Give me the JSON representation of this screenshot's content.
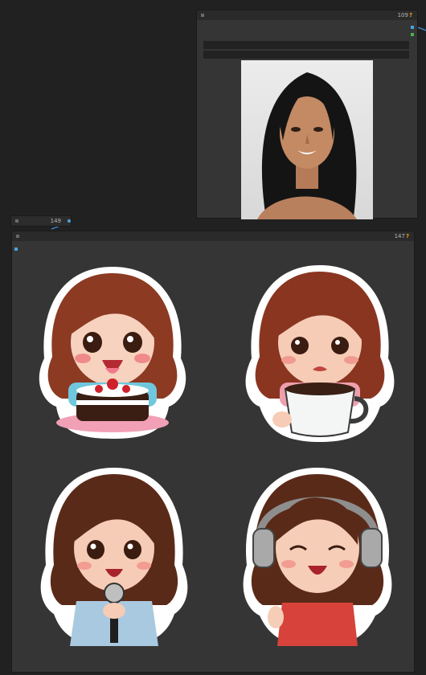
{
  "nodes": {
    "load_image": {
      "id": "109",
      "q": "?"
    },
    "reroute": {
      "id": "149"
    },
    "preview": {
      "id": "147",
      "q": "?"
    }
  },
  "colors": {
    "canvas": "#212121",
    "node_body": "#353535",
    "node_header": "#2a2a2a",
    "badge": "#f0a020",
    "port_blue": "#4aa3df",
    "port_green": "#4caf50",
    "link": "#3b7fc4"
  },
  "images": {
    "source_photo": "woman-portrait",
    "stickers": [
      {
        "name": "sticker-girl-with-cake"
      },
      {
        "name": "sticker-girl-with-coffee"
      },
      {
        "name": "sticker-girl-with-microphone"
      },
      {
        "name": "sticker-girl-with-headphones"
      }
    ]
  }
}
